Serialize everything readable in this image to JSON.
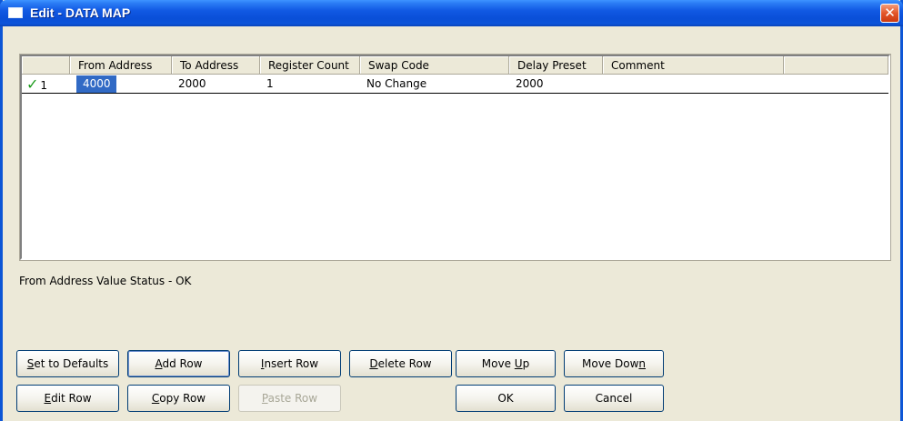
{
  "window": {
    "title": "Edit - DATA MAP",
    "close_glyph": "✕"
  },
  "grid": {
    "columns": [
      "From Address",
      "To Address",
      "Register Count",
      "Swap Code",
      "Delay Preset",
      "Comment"
    ],
    "rows": [
      {
        "row_number": "1",
        "row_icon": "check-icon",
        "from_address": "4000",
        "to_address": "2000",
        "register_count": "1",
        "swap_code": "No Change",
        "delay_preset": "2000",
        "comment": ""
      }
    ]
  },
  "status": {
    "text": "From Address Value Status - OK"
  },
  "buttons": {
    "set_defaults": {
      "pre": "",
      "key": "S",
      "post": "et to Defaults"
    },
    "add_row": {
      "pre": "",
      "key": "A",
      "post": "dd Row"
    },
    "insert_row": {
      "pre": "",
      "key": "I",
      "post": "nsert Row"
    },
    "delete_row": {
      "pre": "",
      "key": "D",
      "post": "elete Row"
    },
    "move_up": {
      "pre": "Move ",
      "key": "U",
      "post": "p"
    },
    "move_down": {
      "pre": "Move Dow",
      "key": "n",
      "post": ""
    },
    "edit_row": {
      "pre": "",
      "key": "E",
      "post": "dit Row"
    },
    "copy_row": {
      "pre": "",
      "key": "C",
      "post": "opy Row"
    },
    "paste_row": {
      "pre": "",
      "key": "P",
      "post": "aste Row",
      "disabled": true
    },
    "ok": {
      "label": "OK"
    },
    "cancel": {
      "label": "Cancel"
    }
  },
  "colors": {
    "selection": "#316ac5",
    "check": "#1a9a1a",
    "titlebar": "#0a4fd8"
  }
}
